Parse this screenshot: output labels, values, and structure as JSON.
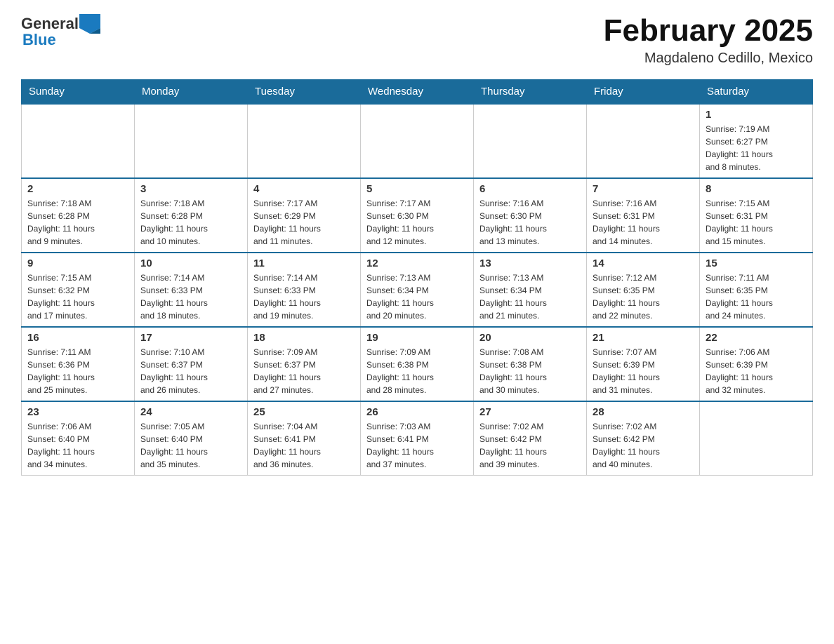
{
  "header": {
    "title": "February 2025",
    "subtitle": "Magdaleno Cedillo, Mexico",
    "logo_general": "General",
    "logo_blue": "Blue"
  },
  "days_of_week": [
    "Sunday",
    "Monday",
    "Tuesday",
    "Wednesday",
    "Thursday",
    "Friday",
    "Saturday"
  ],
  "weeks": [
    [
      {
        "day": "",
        "info": ""
      },
      {
        "day": "",
        "info": ""
      },
      {
        "day": "",
        "info": ""
      },
      {
        "day": "",
        "info": ""
      },
      {
        "day": "",
        "info": ""
      },
      {
        "day": "",
        "info": ""
      },
      {
        "day": "1",
        "info": "Sunrise: 7:19 AM\nSunset: 6:27 PM\nDaylight: 11 hours\nand 8 minutes."
      }
    ],
    [
      {
        "day": "2",
        "info": "Sunrise: 7:18 AM\nSunset: 6:28 PM\nDaylight: 11 hours\nand 9 minutes."
      },
      {
        "day": "3",
        "info": "Sunrise: 7:18 AM\nSunset: 6:28 PM\nDaylight: 11 hours\nand 10 minutes."
      },
      {
        "day": "4",
        "info": "Sunrise: 7:17 AM\nSunset: 6:29 PM\nDaylight: 11 hours\nand 11 minutes."
      },
      {
        "day": "5",
        "info": "Sunrise: 7:17 AM\nSunset: 6:30 PM\nDaylight: 11 hours\nand 12 minutes."
      },
      {
        "day": "6",
        "info": "Sunrise: 7:16 AM\nSunset: 6:30 PM\nDaylight: 11 hours\nand 13 minutes."
      },
      {
        "day": "7",
        "info": "Sunrise: 7:16 AM\nSunset: 6:31 PM\nDaylight: 11 hours\nand 14 minutes."
      },
      {
        "day": "8",
        "info": "Sunrise: 7:15 AM\nSunset: 6:31 PM\nDaylight: 11 hours\nand 15 minutes."
      }
    ],
    [
      {
        "day": "9",
        "info": "Sunrise: 7:15 AM\nSunset: 6:32 PM\nDaylight: 11 hours\nand 17 minutes."
      },
      {
        "day": "10",
        "info": "Sunrise: 7:14 AM\nSunset: 6:33 PM\nDaylight: 11 hours\nand 18 minutes."
      },
      {
        "day": "11",
        "info": "Sunrise: 7:14 AM\nSunset: 6:33 PM\nDaylight: 11 hours\nand 19 minutes."
      },
      {
        "day": "12",
        "info": "Sunrise: 7:13 AM\nSunset: 6:34 PM\nDaylight: 11 hours\nand 20 minutes."
      },
      {
        "day": "13",
        "info": "Sunrise: 7:13 AM\nSunset: 6:34 PM\nDaylight: 11 hours\nand 21 minutes."
      },
      {
        "day": "14",
        "info": "Sunrise: 7:12 AM\nSunset: 6:35 PM\nDaylight: 11 hours\nand 22 minutes."
      },
      {
        "day": "15",
        "info": "Sunrise: 7:11 AM\nSunset: 6:35 PM\nDaylight: 11 hours\nand 24 minutes."
      }
    ],
    [
      {
        "day": "16",
        "info": "Sunrise: 7:11 AM\nSunset: 6:36 PM\nDaylight: 11 hours\nand 25 minutes."
      },
      {
        "day": "17",
        "info": "Sunrise: 7:10 AM\nSunset: 6:37 PM\nDaylight: 11 hours\nand 26 minutes."
      },
      {
        "day": "18",
        "info": "Sunrise: 7:09 AM\nSunset: 6:37 PM\nDaylight: 11 hours\nand 27 minutes."
      },
      {
        "day": "19",
        "info": "Sunrise: 7:09 AM\nSunset: 6:38 PM\nDaylight: 11 hours\nand 28 minutes."
      },
      {
        "day": "20",
        "info": "Sunrise: 7:08 AM\nSunset: 6:38 PM\nDaylight: 11 hours\nand 30 minutes."
      },
      {
        "day": "21",
        "info": "Sunrise: 7:07 AM\nSunset: 6:39 PM\nDaylight: 11 hours\nand 31 minutes."
      },
      {
        "day": "22",
        "info": "Sunrise: 7:06 AM\nSunset: 6:39 PM\nDaylight: 11 hours\nand 32 minutes."
      }
    ],
    [
      {
        "day": "23",
        "info": "Sunrise: 7:06 AM\nSunset: 6:40 PM\nDaylight: 11 hours\nand 34 minutes."
      },
      {
        "day": "24",
        "info": "Sunrise: 7:05 AM\nSunset: 6:40 PM\nDaylight: 11 hours\nand 35 minutes."
      },
      {
        "day": "25",
        "info": "Sunrise: 7:04 AM\nSunset: 6:41 PM\nDaylight: 11 hours\nand 36 minutes."
      },
      {
        "day": "26",
        "info": "Sunrise: 7:03 AM\nSunset: 6:41 PM\nDaylight: 11 hours\nand 37 minutes."
      },
      {
        "day": "27",
        "info": "Sunrise: 7:02 AM\nSunset: 6:42 PM\nDaylight: 11 hours\nand 39 minutes."
      },
      {
        "day": "28",
        "info": "Sunrise: 7:02 AM\nSunset: 6:42 PM\nDaylight: 11 hours\nand 40 minutes."
      },
      {
        "day": "",
        "info": ""
      }
    ]
  ]
}
